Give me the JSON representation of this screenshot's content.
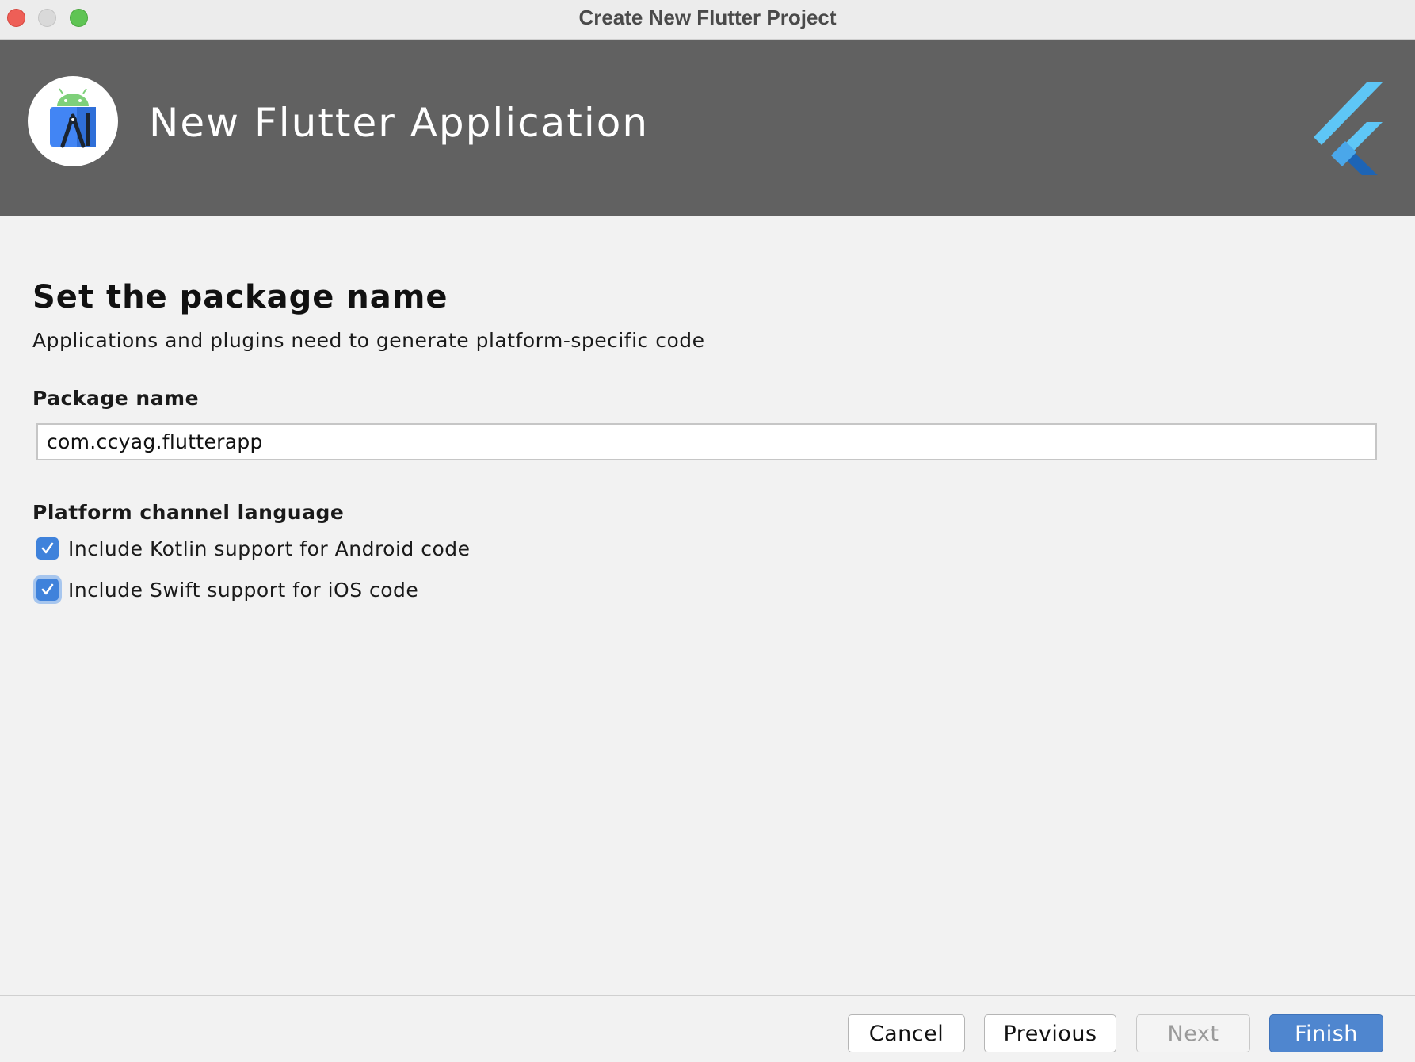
{
  "window": {
    "title": "Create New Flutter Project"
  },
  "banner": {
    "title": "New Flutter Application",
    "left_icon": "android-studio-icon",
    "right_icon": "flutter-logo-icon"
  },
  "content": {
    "heading": "Set the package name",
    "subheading": "Applications and plugins need to generate platform-specific code",
    "package_label": "Package name",
    "package_value": "com.ccyag.flutterapp",
    "platform_label": "Platform channel language",
    "options": [
      {
        "label": "Include Kotlin support for Android code",
        "checked": true
      },
      {
        "label": "Include Swift support for iOS code",
        "checked": true
      }
    ]
  },
  "footer": {
    "cancel": "Cancel",
    "previous": "Previous",
    "next": "Next",
    "finish": "Finish"
  },
  "colors": {
    "banner": "#616161",
    "accent": "#3f82db",
    "finish_button": "#4f86cf",
    "flutter_light": "#5ec6f6",
    "flutter_dark": "#1d64b5"
  }
}
